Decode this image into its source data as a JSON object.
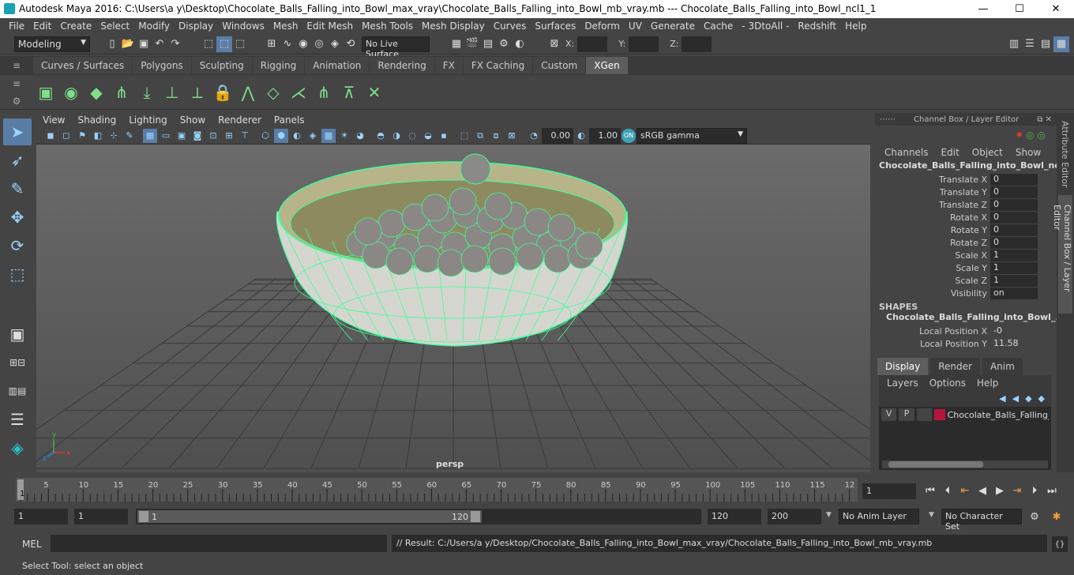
{
  "title_bar": {
    "title": "Autodesk Maya 2016: C:\\Users\\a y\\Desktop\\Chocolate_Balls_Falling_into_Bowl_max_vray\\Chocolate_Balls_Falling_into_Bowl_mb_vray.mb   ---   Chocolate_Balls_Falling_into_Bowl_ncl1_1",
    "minimize": "—",
    "maximize": "☐",
    "close": "✕"
  },
  "menu": [
    "File",
    "Edit",
    "Create",
    "Select",
    "Modify",
    "Display",
    "Windows",
    "Mesh",
    "Edit Mesh",
    "Mesh Tools",
    "Mesh Display",
    "Curves",
    "Surfaces",
    "Deform",
    "UV",
    "Generate",
    "Cache",
    "- 3DtoAll -",
    "Redshift",
    "Help"
  ],
  "status_line": {
    "mode": "Modeling",
    "live_surface": "No Live Surface",
    "x_label": "X:",
    "y_label": "Y:",
    "z_label": "Z:"
  },
  "shelf_tabs": [
    "Curves / Surfaces",
    "Polygons",
    "Sculpting",
    "Rigging",
    "Animation",
    "Rendering",
    "FX",
    "FX Caching",
    "Custom",
    "XGen"
  ],
  "active_shelf_tab": "XGen",
  "viewport": {
    "menu": [
      "View",
      "Shading",
      "Lighting",
      "Show",
      "Renderer",
      "Panels"
    ],
    "exposure": "0.00",
    "gamma": "1.00",
    "color_space": "sRGB gamma",
    "camera_label": "persp"
  },
  "channel_box": {
    "header": "Channel Box / Layer Editor",
    "menu": [
      "Channels",
      "Edit",
      "Object",
      "Show"
    ],
    "object_name": "Chocolate_Balls_Falling_into_Bowl_ncl...",
    "channels": [
      {
        "label": "Translate X",
        "value": "0"
      },
      {
        "label": "Translate Y",
        "value": "0"
      },
      {
        "label": "Translate Z",
        "value": "0"
      },
      {
        "label": "Rotate X",
        "value": "0"
      },
      {
        "label": "Rotate Y",
        "value": "0"
      },
      {
        "label": "Rotate Z",
        "value": "0"
      },
      {
        "label": "Scale X",
        "value": "1"
      },
      {
        "label": "Scale Y",
        "value": "1"
      },
      {
        "label": "Scale Z",
        "value": "1"
      },
      {
        "label": "Visibility",
        "value": "on"
      }
    ],
    "shapes_header": "SHAPES",
    "shape_name": "Chocolate_Balls_Falling_into_Bowl_...",
    "shape_channels": [
      {
        "label": "Local Position X",
        "value": "-0"
      },
      {
        "label": "Local Position Y",
        "value": "11.58"
      }
    ]
  },
  "layer_editor": {
    "tabs": [
      "Display",
      "Render",
      "Anim"
    ],
    "active_tab": "Display",
    "menu": [
      "Layers",
      "Options",
      "Help"
    ],
    "layer": {
      "v": "V",
      "p": "P",
      "name": "Chocolate_Balls_Falling_",
      "color": "#b5163a"
    }
  },
  "side_tabs": [
    "Attribute Editor",
    "Channel Box / Layer Editor"
  ],
  "timeline": {
    "ticks": [
      "5",
      "10",
      "15",
      "20",
      "25",
      "30",
      "35",
      "40",
      "45",
      "50",
      "55",
      "60",
      "65",
      "70",
      "75",
      "80",
      "85",
      "90",
      "95",
      "100",
      "105",
      "110",
      "115",
      "12"
    ],
    "current_frame": "1",
    "frame_field": "1"
  },
  "range": {
    "start": "1",
    "playback_start": "1",
    "slider_start": "1",
    "slider_end": "120",
    "playback_end": "120",
    "end": "200",
    "anim_layer": "No Anim Layer",
    "character_set": "No Character Set"
  },
  "command_line": {
    "lang": "MEL",
    "result": "// Result: C:/Users/a y/Desktop/Chocolate_Balls_Falling_into_Bowl_max_vray/Chocolate_Balls_Falling_into_Bowl_mb_vray.mb"
  },
  "help_line": "Select Tool: select an object",
  "colors": {
    "accent": "#5a7da6",
    "wire": "#3dff9a",
    "bowl": "#d8d8c8"
  }
}
